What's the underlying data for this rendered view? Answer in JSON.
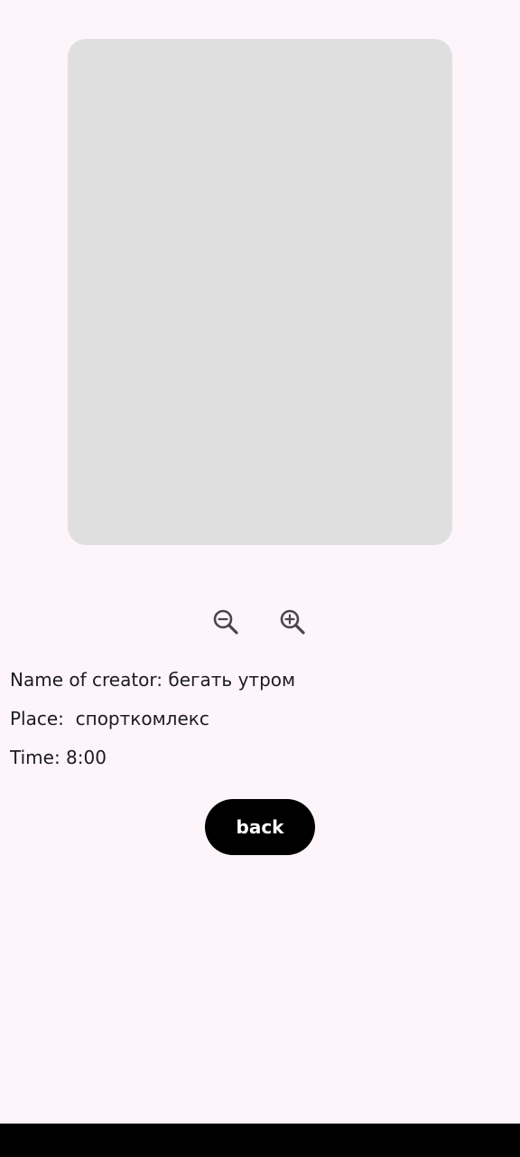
{
  "map": {
    "background": "#e0dfe0"
  },
  "zoom": {
    "out_icon": "zoom-out-icon",
    "in_icon": "zoom-in-icon"
  },
  "info": {
    "creator": "Name of creator: бегать утром",
    "place": "Place:  спорткомлекс",
    "time": "Time: 8:00"
  },
  "back_button": {
    "label": "back"
  },
  "colors": {
    "page_background": "#fdf5fa",
    "text": "#1d1b20",
    "button_background": "#000000",
    "button_text": "#ffffff"
  }
}
